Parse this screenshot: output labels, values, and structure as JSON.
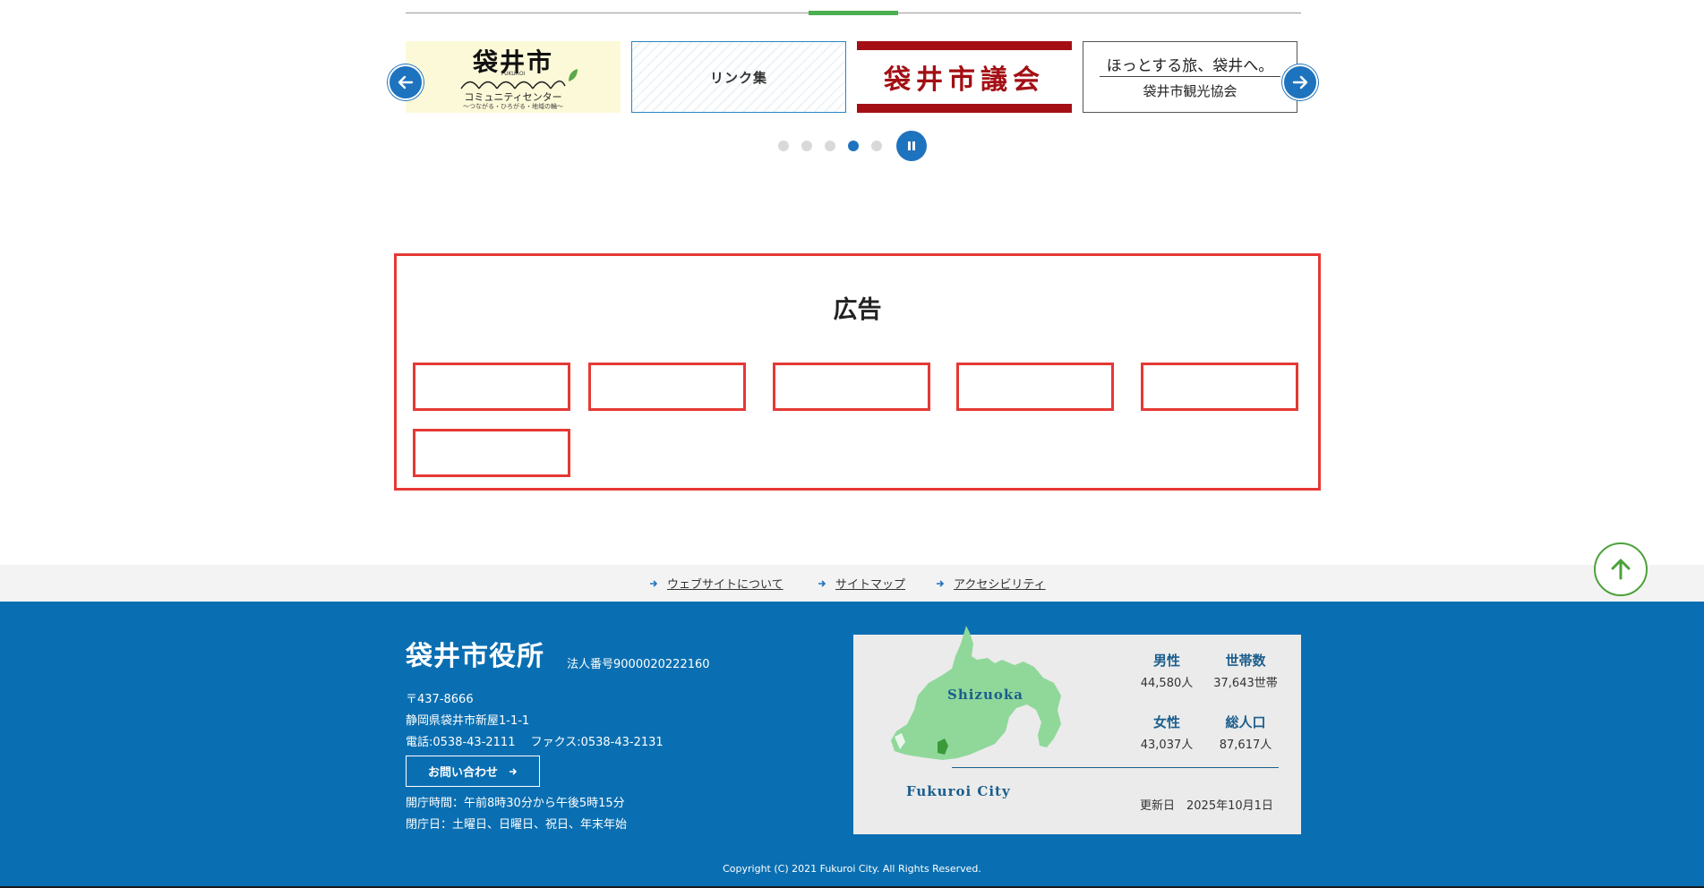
{
  "colors": {
    "primary_blue": "#1e73be",
    "footer_blue": "#0a6fb2",
    "accent_green": "#4caf50",
    "ad_red": "#e53935",
    "council_red": "#a30f14",
    "map_green": "#8fd89a"
  },
  "carousel": {
    "prev_icon": "arrow-left-icon",
    "next_icon": "arrow-right-icon",
    "slides": [
      {
        "title": "袋井市",
        "subtitle": "FUKUROI",
        "label": "コミュニティセンター",
        "tagline": "〜つながる・ひろがる・地域の輪〜"
      },
      {
        "label": "リンク集"
      },
      {
        "label": "袋井市議会"
      },
      {
        "line1": "ほっとする旅、袋井へ。",
        "line2": "袋井市観光協会"
      }
    ],
    "dots": {
      "count": 5,
      "active_index": 3
    },
    "pause_icon": "pause-icon"
  },
  "ads": {
    "title": "広告",
    "slot_count": 6
  },
  "footer_links": [
    {
      "label": "ウェブサイトについて"
    },
    {
      "label": "サイトマップ"
    },
    {
      "label": "アクセシビリティ"
    }
  ],
  "footer": {
    "org_name": "袋井市役所",
    "corp_number": "法人番号9000020222160",
    "postal": "〒437-8666",
    "address": "静岡県袋井市新屋1-1-1",
    "phone": "電話:0538-43-2111　 ファクス:0538-43-2131",
    "contact_label": "お問い合わせ",
    "hours": "開庁時間：午前8時30分から午後5時15分",
    "closed": "閉庁日：土曜日、日曜日、祝日、年末年始",
    "copyright": "Copyright (C) 2021 Fukuroi City. All Rights Reserved."
  },
  "stats": {
    "map_label_prefecture": "Shizuoka",
    "map_label_city": "Fukuroi City",
    "male_label": "男性",
    "male_value": "44,580人",
    "households_label": "世帯数",
    "households_value": "37,643世帯",
    "female_label": "女性",
    "female_value": "43,037人",
    "total_label": "総人口",
    "total_value": "87,617人",
    "updated": "更新日　2025年10月1日"
  }
}
